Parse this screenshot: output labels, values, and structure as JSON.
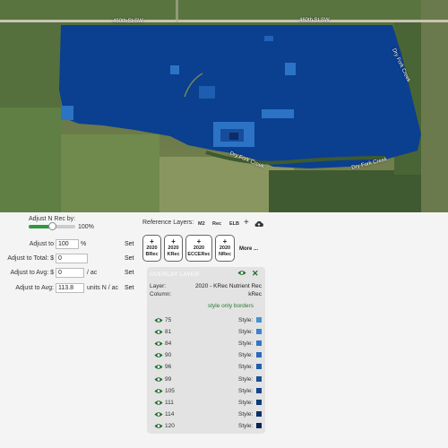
{
  "map": {
    "road_name": "460th St SW",
    "road_name_right": "460th St SW",
    "creek_left": "Dry Fork Creek",
    "creek_right": "Dry Fork Creek",
    "creek_vertical": "Dry Fork Creek",
    "overlay_color": "#0b3f8f"
  },
  "adjust": {
    "title": "Adjust N Rec by:",
    "slider_value_label": "100%",
    "slider_fraction": 0.5,
    "rows": [
      {
        "label": "Adjust to",
        "value": "100",
        "unit": "%",
        "set": "Set"
      },
      {
        "label": "Adjust to Total: $",
        "value": "0",
        "unit": "",
        "set": "Set"
      },
      {
        "label": "Adjust to Avg: $",
        "value": "0",
        "unit": "/ ac",
        "set": "Set"
      },
      {
        "label": "Adjust to Avg:",
        "value": "113.8",
        "unit": "units N / ac",
        "set": "Set"
      }
    ]
  },
  "reference": {
    "title": "Reference Layers:",
    "tabs": [
      "M2",
      "Rec",
      "ELB"
    ],
    "buttons": [
      {
        "plus": "+",
        "year": "2020",
        "name": "BRec"
      },
      {
        "plus": "+",
        "year": "2020",
        "name": "KRec"
      },
      {
        "plus": "+",
        "year": "2020",
        "name": "ECCERec"
      },
      {
        "plus": "+",
        "year": "2020",
        "name": "NRec"
      }
    ],
    "more": "More ..."
  },
  "panel": {
    "title": "OVERLAY LAYER",
    "layer_label": "Layer:",
    "layer_value": "2020 - KRec Nutrient Rec",
    "column_label": "Column:",
    "column_value": "kRec",
    "style_only_borders": "style only borders",
    "style_label": "Style:",
    "legend": [
      {
        "value": "75",
        "color": "#4a90d9"
      },
      {
        "value": "81",
        "color": "#3d83cf"
      },
      {
        "value": "84",
        "color": "#3277c4"
      },
      {
        "value": "90",
        "color": "#2a6ab8"
      },
      {
        "value": "96",
        "color": "#225ea9"
      },
      {
        "value": "99",
        "color": "#1b5199"
      },
      {
        "value": "105",
        "color": "#154689"
      },
      {
        "value": "111",
        "color": "#0f3a78"
      },
      {
        "value": "114",
        "color": "#0b3066"
      },
      {
        "value": "120",
        "color": "#072456"
      }
    ]
  }
}
